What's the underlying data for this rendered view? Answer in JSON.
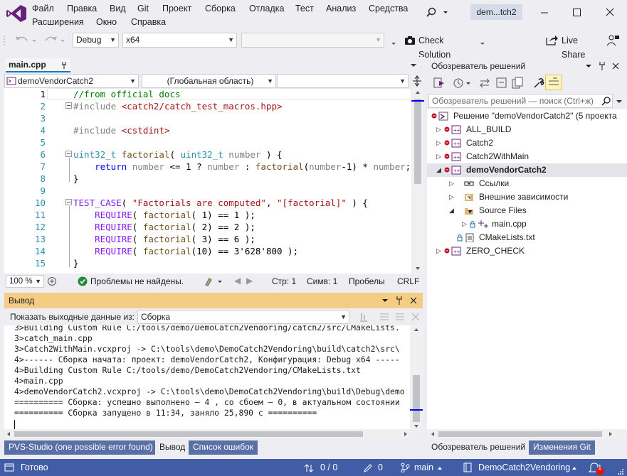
{
  "menu": {
    "items": [
      "Файл",
      "Правка",
      "Вид",
      "Git",
      "Проект",
      "Сборка",
      "Отладка",
      "Тест",
      "Анализ",
      "Средства",
      "Расширения",
      "Окно",
      "Справка"
    ],
    "solution_title": "dem...tch2"
  },
  "toolbar": {
    "config": "Debug",
    "platform": "x64",
    "startup": "",
    "check_solution": "Check Solution",
    "live_share": "Live Share"
  },
  "editor": {
    "tab": "main.cpp",
    "nav_project": "demoVendorCatch2",
    "nav_scope": "(Глобальная область)",
    "nav_member": "",
    "line_numbers": [
      "1",
      "2",
      "3",
      "4",
      "5",
      "6",
      "7",
      "8",
      "9",
      "10",
      "11",
      "12",
      "13",
      "14",
      "15"
    ],
    "status": {
      "zoom": "100 %",
      "issues": "Проблемы не найдены.",
      "line": "Стр: 1",
      "col": "Симв: 1",
      "spaces": "Пробелы",
      "eol": "CRLF"
    }
  },
  "output": {
    "title": "Вывод",
    "show_label": "Показать выходные данные из:",
    "source": "Сборка",
    "lines": [
      "3>Building Custom Rule C:/tools/demo/DemoCatch2Vendoring/catch2/src/CMakeLists.",
      "3>catch_main.cpp",
      "3>Catch2WithMain.vcxproj -> C:\\tools\\demo\\DemoCatch2Vendoring\\build\\catch2\\src\\",
      "4>------ Сборка начата: проект: demoVendorCatch2, Конфигурация: Debug x64 -----",
      "4>Building Custom Rule C:/tools/demo/DemoCatch2Vendoring/CMakeLists.txt",
      "4>main.cpp",
      "4>demoVendorCatch2.vcxproj -> C:\\tools\\demo\\DemoCatch2Vendoring\\build\\Debug\\demo",
      "========== Сборка: успешно выполнено — 4 , со сбоем — 0, в актуальном состоянии",
      "========== Сборка запущено в 11:34, заняло 25,890 с =========="
    ],
    "tabs": [
      "PVS-Studio (one possible error found)",
      "Вывод",
      "Список ошибок"
    ]
  },
  "solution_explorer": {
    "title": "Обозреватель решений",
    "search_placeholder": "Обозреватель решений — поиск (Ctrl+ж)",
    "solution": "Решение \"demoVendorCatch2\" (5 проекта",
    "projects": [
      "ALL_BUILD",
      "Catch2",
      "Catch2WithMain",
      "demoVendorCatch2",
      "ZERO_CHECK"
    ],
    "refs": "Ссылки",
    "external": "Внешние зависимости",
    "source_files": "Source Files",
    "main_cpp": "main.cpp",
    "cmake": "CMakeLists.txt",
    "tabs": [
      "Обозреватель решений",
      "Изменения Git"
    ]
  },
  "statusbar": {
    "ready": "Готово",
    "sync": "0 / 0",
    "changes": "0",
    "branch": "main",
    "repo": "DemoCatch2Vendoring",
    "notifications": "1"
  },
  "colors": {
    "accent": "#007acc",
    "statusbar": "#415da6",
    "output_header": "#f5cc84"
  }
}
